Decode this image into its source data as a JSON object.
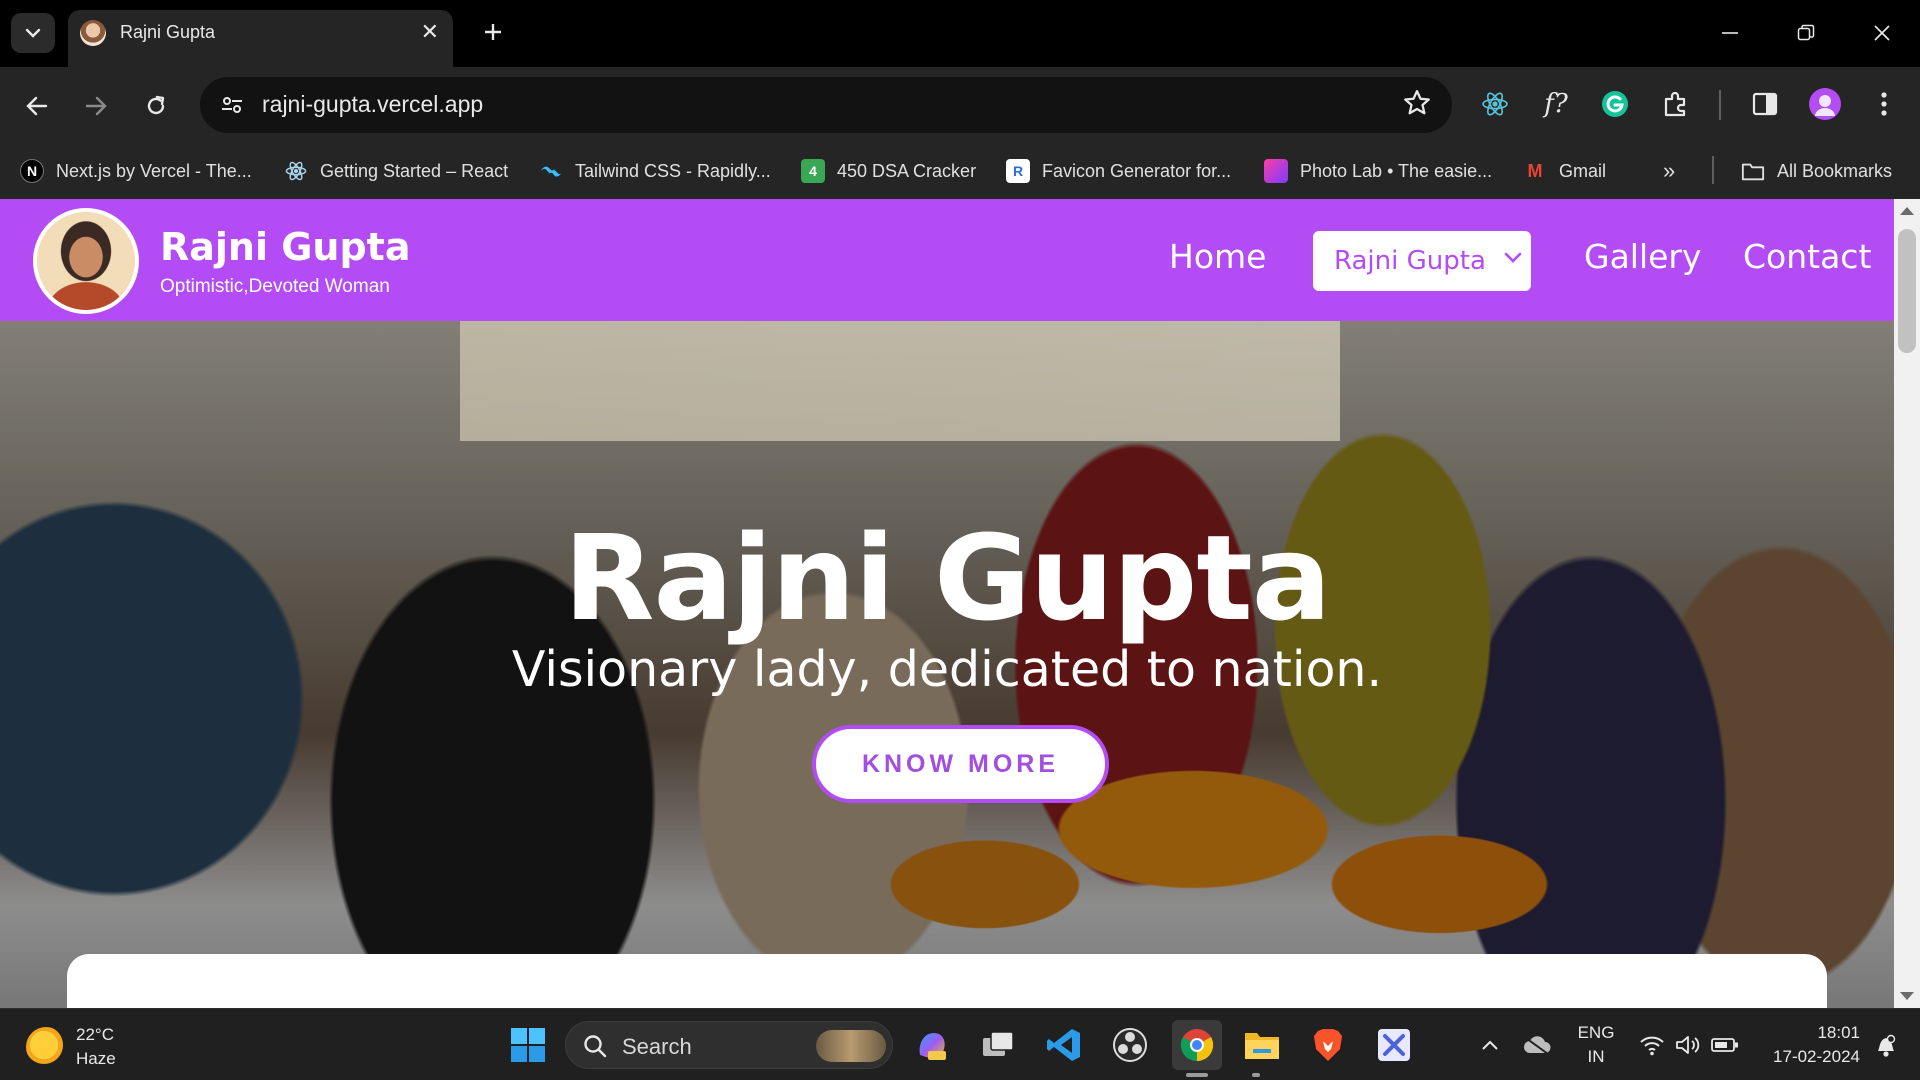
{
  "browser": {
    "tab_title": "Rajni Gupta",
    "url": "rajni-gupta.vercel.app",
    "bookmarks": [
      {
        "label": "Next.js by Vercel - The...",
        "icon": "nextjs-icon"
      },
      {
        "label": "Getting Started – React",
        "icon": "react-icon"
      },
      {
        "label": "Tailwind CSS - Rapidly...",
        "icon": "tailwind-icon"
      },
      {
        "label": "450 DSA Cracker",
        "icon": "dsa-icon",
        "glyph": "4"
      },
      {
        "label": "Favicon Generator for...",
        "icon": "favicon-icon",
        "glyph": "R"
      },
      {
        "label": "Photo Lab • The easie...",
        "icon": "photolab-icon"
      },
      {
        "label": "Gmail",
        "icon": "gmail-icon",
        "glyph": "M"
      }
    ],
    "all_bookmarks": "All Bookmarks",
    "extension_fx": "f?"
  },
  "site": {
    "brand_name": "Rajni Gupta",
    "brand_tagline": "Optimistic,Devoted Woman",
    "nav": {
      "home": "Home",
      "dropdown": "Rajni Gupta",
      "gallery": "Gallery",
      "contact": "Contact"
    },
    "hero": {
      "title": "Rajni Gupta",
      "subtitle": "Visionary lady, dedicated to nation.",
      "button": "KNOW MORE"
    },
    "accent_color": "#b44cf6"
  },
  "taskbar": {
    "weather_temp": "22°C",
    "weather_desc": "Haze",
    "search_label": "Search",
    "lang": "ENG",
    "region": "IN",
    "time": "18:01",
    "date": "17-02-2024"
  }
}
